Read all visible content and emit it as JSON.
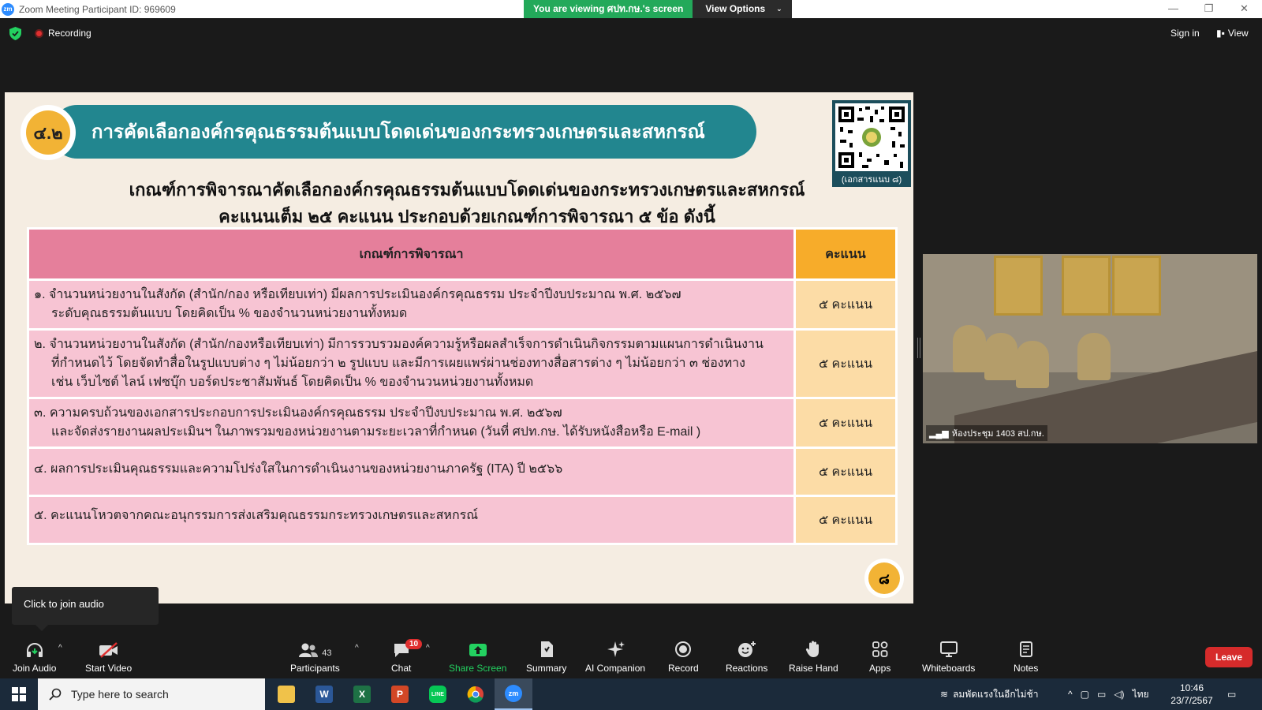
{
  "window": {
    "title": "Zoom Meeting Participant ID: 969609",
    "share_banner": "You are viewing ศปท.กษ.'s screen",
    "view_options": "View Options",
    "minimize": "—",
    "restore": "❐",
    "close": "✕"
  },
  "topbar": {
    "recording": "Recording",
    "sign_in": "Sign in",
    "view": "View"
  },
  "slide": {
    "badge": "๔.๒",
    "header_title": "การคัดเลือกองค์กรคุณธรรมต้นแบบโดดเด่นของกระทรวงเกษตรและสหกรณ์",
    "qr_caption": "(เอกสารแนบ ๘)",
    "subtitle_line1": "เกณฑ์การพิจารณาคัดเลือกองค์กรคุณธรรมต้นแบบโดดเด่นของกระทรวงเกษตรและสหกรณ์",
    "subtitle_line2": "คะแนนเต็ม ๒๕ คะแนน ประกอบด้วยเกณฑ์การพิจารณา ๕ ข้อ ดังนี้",
    "table": {
      "header_criteria": "เกณฑ์การพิจารณา",
      "header_score": "คะแนน",
      "rows": [
        {
          "lines": [
            "๑. จำนวนหน่วยงานในสังกัด (สำนัก/กอง หรือเทียบเท่า) มีผลการประเมินองค์กรคุณธรรม ประจำปีงบประมาณ พ.ศ. ๒๕๖๗",
            "ระดับคุณธรรมต้นแบบ โดยคิดเป็น % ของจำนวนหน่วยงานทั้งหมด",
            ""
          ],
          "score": "๕ คะแนน"
        },
        {
          "lines": [
            "๒. จำนวนหน่วยงานในสังกัด (สำนัก/กองหรือเทียบเท่า) มีการรวบรวมองค์ความรู้หรือผลสำเร็จการดำเนินกิจกรรมตามแผนการดำเนินงาน",
            "ที่กำหนดไว้ โดยจัดทำสื่อในรูปแบบต่าง ๆ ไม่น้อยกว่า ๒ รูปแบบ และมีการเผยแพร่ผ่านช่องทางสื่อสารต่าง ๆ ไม่น้อยกว่า ๓ ช่องทาง",
            "เช่น เว็บไซต์ ไลน์ เฟซบุ๊ก บอร์ดประชาสัมพันธ์ โดยคิดเป็น % ของจำนวนหน่วยงานทั้งหมด"
          ],
          "score": "๕ คะแนน"
        },
        {
          "lines": [
            "๓. ความครบถ้วนของเอกสารประกอบการประเมินองค์กรคุณธรรม ประจำปีงบประมาณ พ.ศ. ๒๕๖๗",
            "และจัดส่งรายงานผลประเมินฯ ในภาพรวมของหน่วยงานตามระยะเวลาที่กำหนด (วันที่ ศปท.กษ. ได้รับหนังสือหรือ E-mail )",
            ""
          ],
          "score": "๕ คะแนน"
        },
        {
          "lines": [
            "๔. ผลการประเมินคุณธรรมและความโปร่งใสในการดำเนินงานของหน่วยงานภาครัฐ (ITA) ปี ๒๕๖๖",
            "",
            ""
          ],
          "score": "๕ คะแนน"
        },
        {
          "lines": [
            "๕. คะแนนโหวตจากคณะอนุกรรมการส่งเสริมคุณธรรมกระทรวงเกษตรและสหกรณ์",
            "",
            ""
          ],
          "score": "๕ คะแนน"
        }
      ]
    },
    "page_number": "๘"
  },
  "video": {
    "participant_name": "ห้องประชุม 1403 สป.กษ."
  },
  "tooltip": "Click to join audio",
  "toolbar": {
    "join_audio": "Join Audio",
    "start_video": "Start Video",
    "participants": "Participants",
    "participants_count": "43",
    "chat": "Chat",
    "chat_badge": "10",
    "share_screen": "Share Screen",
    "summary": "Summary",
    "ai_companion": "AI Companion",
    "record": "Record",
    "reactions": "Reactions",
    "raise_hand": "Raise Hand",
    "apps": "Apps",
    "whiteboards": "Whiteboards",
    "notes": "Notes",
    "leave": "Leave"
  },
  "taskbar": {
    "search_placeholder": "Type here to search",
    "weather": "ลมพัดแรงในอีกไม่ช้า",
    "language": "ไทย",
    "time": "10:46",
    "date": "23/7/2567"
  },
  "colors": {
    "zoom_blue": "#2d8cff",
    "share_green": "#23a95a",
    "header_teal": "#22868f",
    "badge_orange": "#f2b335",
    "table_pink": "#e57f9b",
    "score_orange": "#f7ac2a",
    "leave_red": "#d62b2b"
  }
}
